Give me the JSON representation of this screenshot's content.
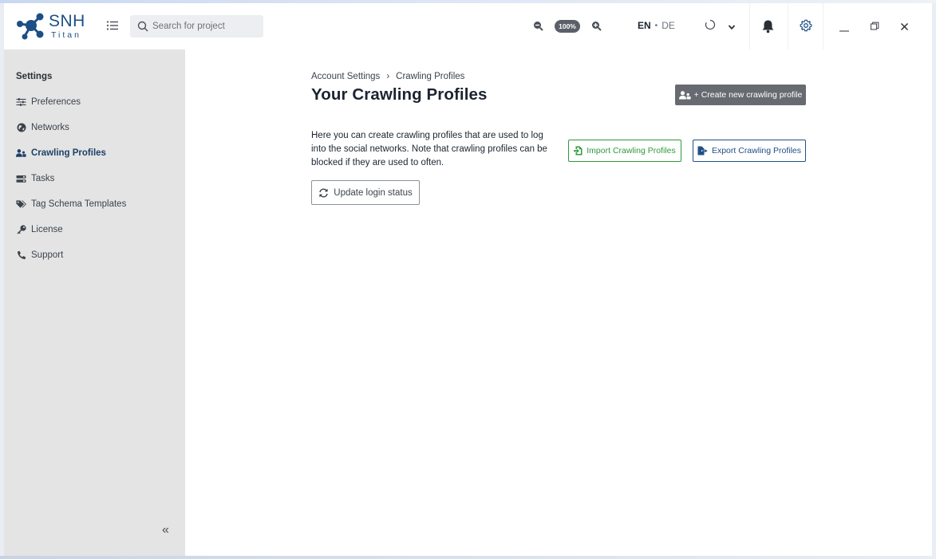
{
  "app": {
    "name": "SNH",
    "subtitle": "Titan"
  },
  "header": {
    "search_placeholder": "Search for project",
    "zoom_level": "100%",
    "lang_active": "EN",
    "lang_separator": "•",
    "lang_other": "DE"
  },
  "sidebar": {
    "title": "Settings",
    "items": [
      {
        "label": "Preferences",
        "icon": "sliders-icon",
        "active": false
      },
      {
        "label": "Networks",
        "icon": "globe-icon",
        "active": false
      },
      {
        "label": "Crawling Profiles",
        "icon": "users-icon",
        "active": true
      },
      {
        "label": "Tasks",
        "icon": "tasks-icon",
        "active": false
      },
      {
        "label": "Tag Schema Templates",
        "icon": "tags-icon",
        "active": false
      },
      {
        "label": "License",
        "icon": "key-icon",
        "active": false
      },
      {
        "label": "Support",
        "icon": "phone-icon",
        "active": false
      }
    ],
    "collapse_label": "«"
  },
  "main": {
    "breadcrumb": [
      "Account Settings",
      "›",
      "Crawling Profiles"
    ],
    "title": "Your Crawling Profiles",
    "create_button": "+ Create new crawling profile",
    "description": "Here you can create crawling profiles that are used to log into the social networks. Note that crawling profiles can be blocked if they are used to often.",
    "import_button": "Import Crawling Profiles",
    "export_button": "Export Crawling Profiles",
    "update_button": "Update login status"
  },
  "colors": {
    "brand": "#1c4f86",
    "sidebar_bg": "#e4e4e4",
    "active_item": "#1d3f68",
    "import_green": "#2e9a3c",
    "export_blue": "#214f87",
    "primary_button": "#676b71"
  }
}
